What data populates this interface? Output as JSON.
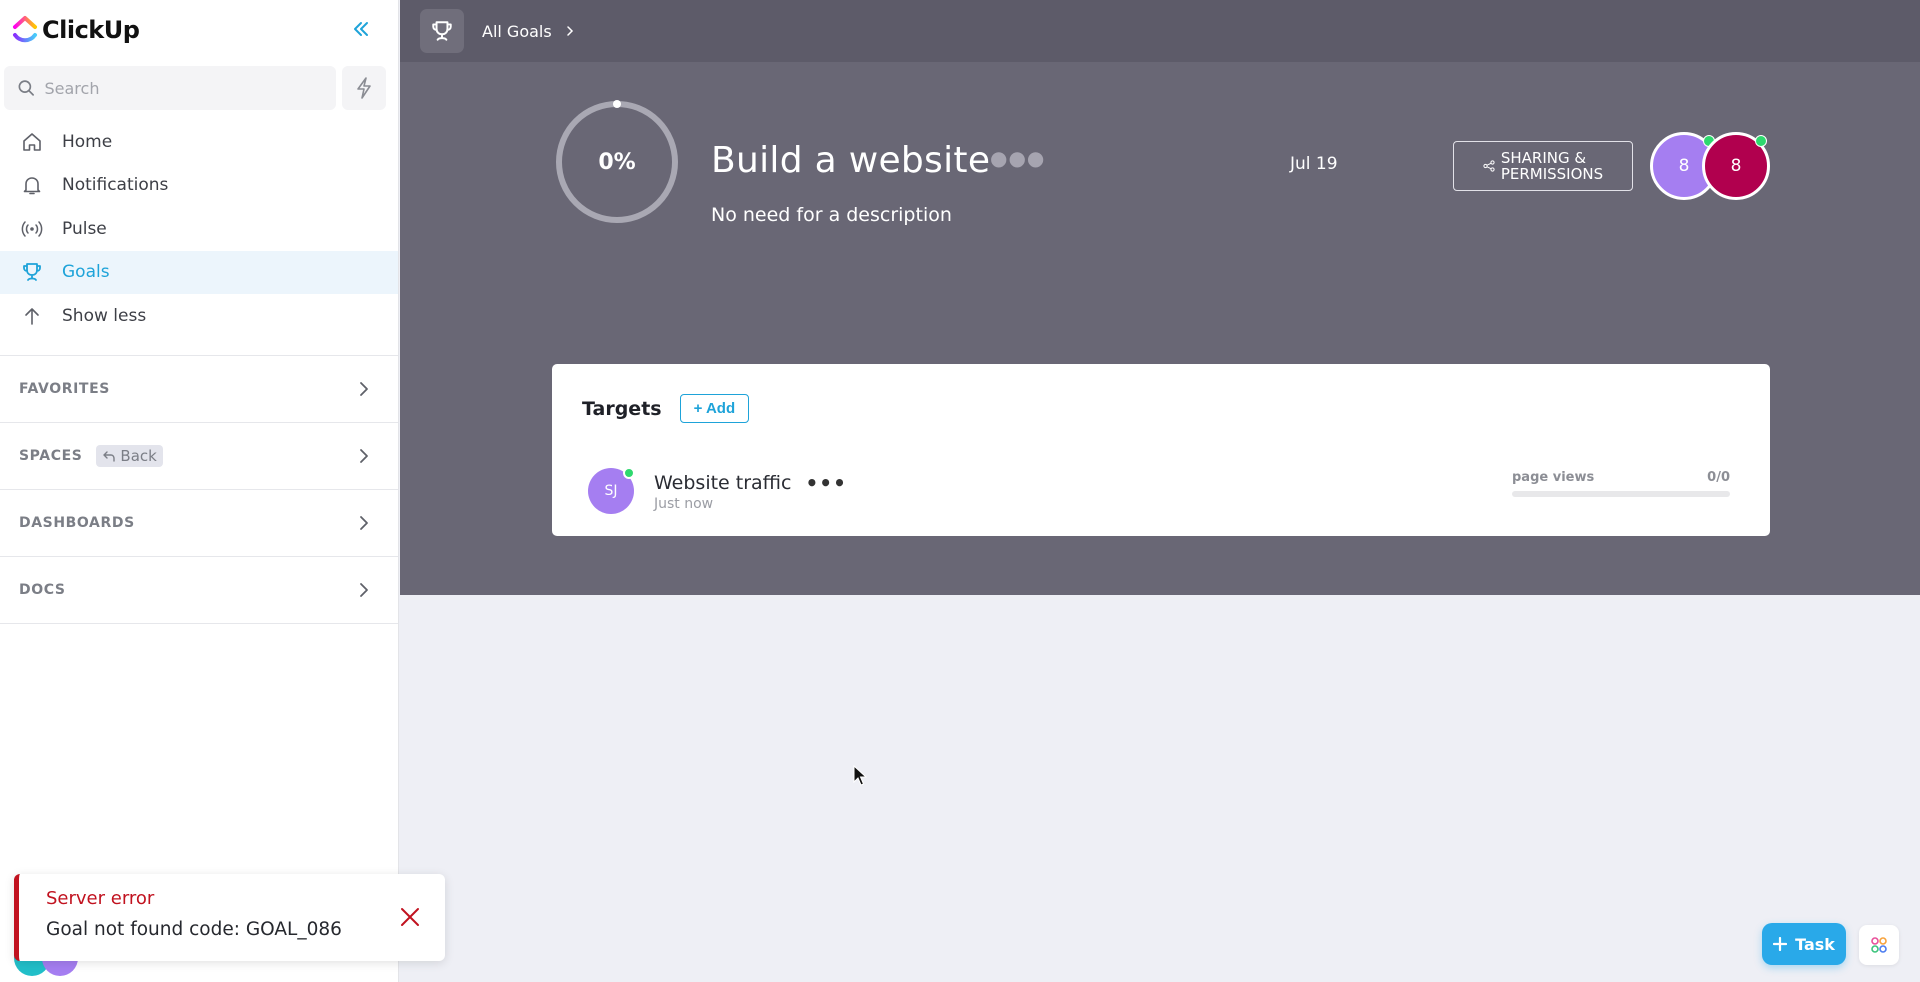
{
  "app": {
    "brand": "ClickUp",
    "colors": {
      "accent": "#1ea3d9",
      "header_bg": "#5d5b69",
      "hero_bg": "#696775",
      "error": "#c1121f",
      "online": "#2ed86e"
    }
  },
  "sidebar": {
    "search": {
      "placeholder": "Search",
      "value": ""
    },
    "nav": [
      {
        "label": "Home",
        "icon": "home-icon",
        "active": false
      },
      {
        "label": "Notifications",
        "icon": "bell-icon",
        "active": false
      },
      {
        "label": "Pulse",
        "icon": "broadcast-icon",
        "active": false
      },
      {
        "label": "Goals",
        "icon": "trophy-icon",
        "active": true
      },
      {
        "label": "Show less",
        "icon": "arrow-up-icon",
        "active": false
      }
    ],
    "sections": [
      {
        "title": "FAVORITES"
      },
      {
        "title": "SPACES",
        "back_label": "Back"
      },
      {
        "title": "DASHBOARDS"
      },
      {
        "title": "DOCS"
      }
    ]
  },
  "topbar": {
    "breadcrumb": "All Goals"
  },
  "goal": {
    "progress_label": "0%",
    "progress_fraction": 0,
    "title": "Build a website",
    "description": "No need for a description",
    "due_date": "Jul 19",
    "share_label_line1": "SHARING &",
    "share_label_line2": "PERMISSIONS",
    "members": [
      {
        "initials": "8",
        "color": "#a57ef1",
        "online": true
      },
      {
        "initials": "8",
        "color": "#b1004e",
        "online": true
      }
    ]
  },
  "targets": {
    "title": "Targets",
    "add_label": "+ Add",
    "items": [
      {
        "owner_initials": "SJ",
        "name": "Website traffic",
        "updated": "Just now",
        "unit": "page views",
        "progress_text": "0/0",
        "progress_fraction": 0
      }
    ]
  },
  "toast": {
    "title": "Server error",
    "message": "Goal not found code: GOAL_086"
  },
  "fab": {
    "task_label": "Task"
  }
}
